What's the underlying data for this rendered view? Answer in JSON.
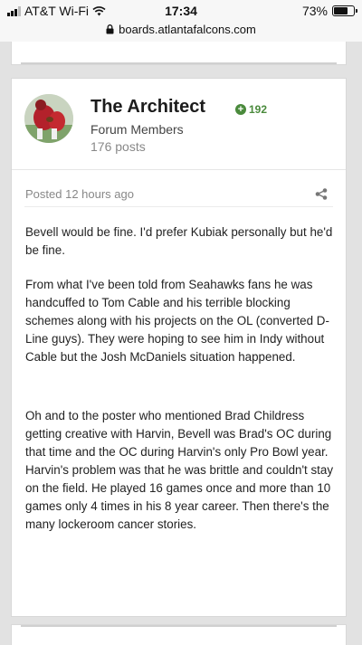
{
  "status_bar": {
    "carrier": "AT&T Wi-Fi",
    "time": "17:34",
    "battery": "73%",
    "battery_level": 0.73
  },
  "browser": {
    "url": "boards.atlantafalcons.com"
  },
  "post": {
    "author": "The Architect",
    "reputation": "192",
    "group": "Forum Members",
    "post_count": "176 posts",
    "posted": "Posted 12 hours ago",
    "paragraphs": [
      "Bevell would be fine. I'd prefer Kubiak personally but he'd be fine.",
      "From what I've been told from Seahawks fans he was handcuffed to Tom Cable and his terrible blocking schemes along with his projects on the OL (converted D-Line guys). They were hoping to see him in Indy without Cable but the Josh McDaniels situation happened.",
      "Oh and to the poster who mentioned Brad Childress getting creative with Harvin, Bevell was Brad's OC during that time and the OC during Harvin's only Pro Bowl year. Harvin's problem was that he was brittle and couldn't stay on the field. He played 16 games once and more than 10 games only 4 times in his 8 year career. Then there's the many lockeroom cancer stories."
    ]
  }
}
